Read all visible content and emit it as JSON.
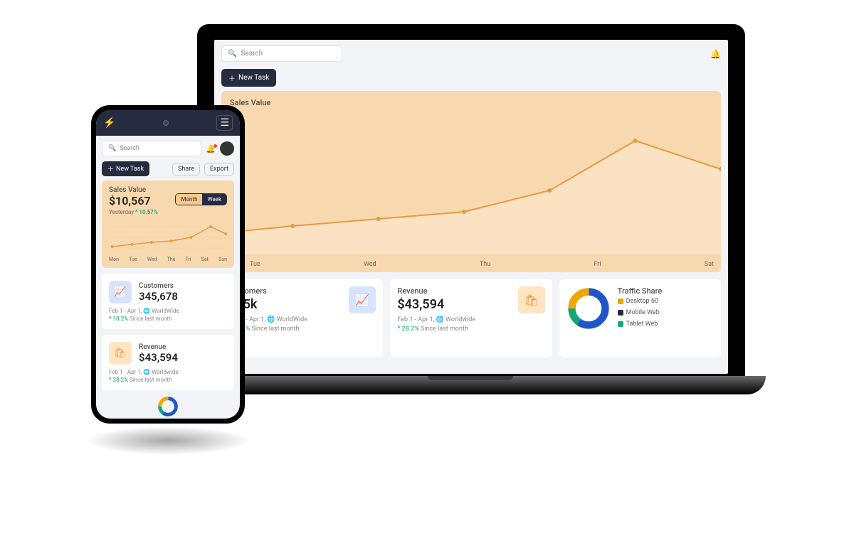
{
  "search_placeholder": "Search",
  "new_task_label": "New Task",
  "share_label": "Share",
  "export_label": "Export",
  "sales": {
    "title": "Sales Value",
    "value": "$10,567",
    "yesterday_label": "Yesterday",
    "yesterday_delta": "10.57%",
    "toggle_month": "Month",
    "toggle_week": "Week"
  },
  "days": [
    "Mon",
    "Tue",
    "Wed",
    "Thu",
    "Fri",
    "Sat",
    "Sun"
  ],
  "days_laptop": [
    "Tue",
    "Wed",
    "Thu",
    "Fri",
    "Sat"
  ],
  "customers": {
    "title": "Customers",
    "value_phone": "345,678",
    "value_laptop": "345k",
    "range": "Feb 1 - Apr 1,",
    "scope": "WorldWide",
    "delta": "18.2%",
    "since": "Since last month"
  },
  "revenue": {
    "title": "Revenue",
    "value": "$43,594",
    "range": "Feb 1 - Apr 1,",
    "scope": "Worldwide",
    "delta": "28.2%",
    "since": "Since last month"
  },
  "traffic": {
    "title": "Traffic Share",
    "items": [
      {
        "label": "Desktop",
        "value": "60",
        "color": "#f0a500"
      },
      {
        "label": "Mobile Web",
        "value": "",
        "color": "#262b40"
      },
      {
        "label": "Tablet Web",
        "value": "",
        "color": "#17a673"
      }
    ]
  },
  "chart_data": {
    "type": "line",
    "title": "Sales Value",
    "categories": [
      "Mon",
      "Tue",
      "Wed",
      "Thu",
      "Fri",
      "Sat",
      "Sun"
    ],
    "values": [
      15,
      20,
      25,
      30,
      45,
      75,
      55
    ],
    "ylim": [
      0,
      100
    ]
  }
}
